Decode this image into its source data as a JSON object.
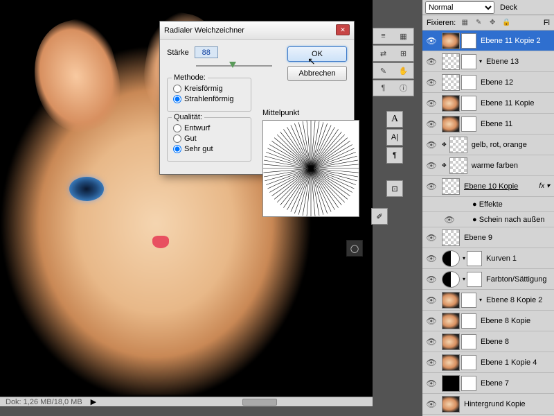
{
  "blend": {
    "mode": "Normal",
    "deck": "Deck"
  },
  "lock": {
    "label": "Fixieren:"
  },
  "status": {
    "doc": "Dok: 1,26 MB/18,0 MB"
  },
  "dialog": {
    "title": "Radialer Weichzeichner",
    "strength_label": "Stärke",
    "strength_value": "88",
    "method_label": "Methode:",
    "method_opts": [
      "Kreisförmig",
      "Strahlenförmig"
    ],
    "quality_label": "Qualität:",
    "quality_opts": [
      "Entwurf",
      "Gut",
      "Sehr gut"
    ],
    "center_label": "Mittelpunkt",
    "ok": "OK",
    "cancel": "Abbrechen"
  },
  "layers": [
    {
      "name": "Ebene 11 Kopie 2",
      "sel": true,
      "th": "cat",
      "mask": true
    },
    {
      "name": "Ebene 13",
      "th": "chk",
      "mask": true,
      "extra": true
    },
    {
      "name": "Ebene 12",
      "th": "chk",
      "mask": true
    },
    {
      "name": "Ebene 11 Kopie",
      "th": "cat",
      "mask": true
    },
    {
      "name": "Ebene 11",
      "th": "cat",
      "mask": true
    },
    {
      "name": "gelb, rot, orange",
      "th": "chk",
      "link": true
    },
    {
      "name": "warme farben",
      "th": "chk",
      "link": true
    },
    {
      "name": "Ebene 10 Kopie",
      "th": "chk",
      "u": true,
      "fx": "fx"
    },
    {
      "sub": true,
      "name": "Effekte"
    },
    {
      "sub": true,
      "name": "Schein nach außen",
      "eye": true
    },
    {
      "name": "Ebene 9",
      "th": "chk"
    },
    {
      "name": "Kurven 1",
      "th": "half",
      "adj": true,
      "mask": true
    },
    {
      "name": "Farbton/Sättigung",
      "th": "half",
      "adj": true,
      "mask": true
    },
    {
      "name": "Ebene 8 Kopie 2",
      "th": "cat",
      "mask": true,
      "extra": true
    },
    {
      "name": "Ebene 8 Kopie",
      "th": "cat",
      "mask": true
    },
    {
      "name": "Ebene 8",
      "th": "cat",
      "mask": true
    },
    {
      "name": "Ebene 1 Kopie 4",
      "th": "cat",
      "mask": true
    },
    {
      "name": "Ebene 7",
      "th": "blk",
      "mask": true
    },
    {
      "name": "Hintergrund Kopie",
      "th": "cat"
    }
  ]
}
